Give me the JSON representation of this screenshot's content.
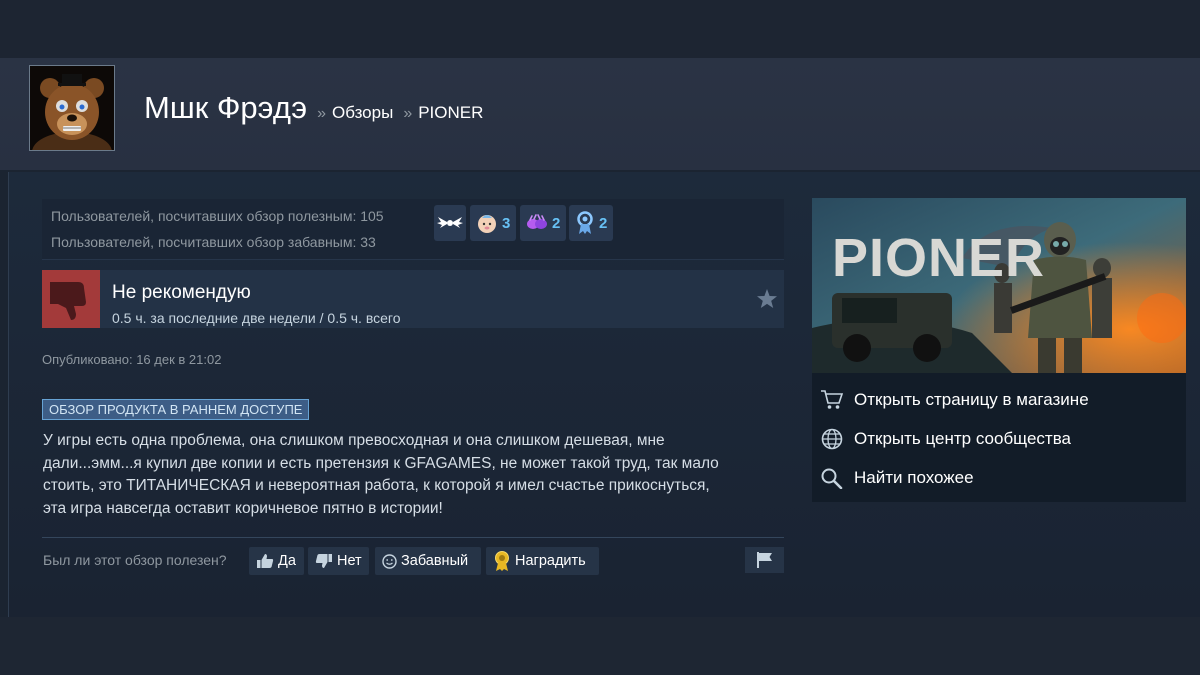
{
  "profile": {
    "username": "Мшк Фрэдэ",
    "breadcrumb": [
      {
        "sep": "»",
        "label": "Обзоры"
      },
      {
        "sep": "»",
        "label": "PIONER"
      }
    ]
  },
  "stats": {
    "helpful_line": "Пользователей, посчитавших обзор полезным: 105",
    "funny_line": "Пользователей, посчитавших обзор забавным: 33"
  },
  "awards": [
    {
      "icon": "wings-award-icon",
      "count": ""
    },
    {
      "icon": "baby-face-award-icon",
      "count": "3"
    },
    {
      "icon": "purple-hands-award-icon",
      "count": "2"
    },
    {
      "icon": "ribbon-medal-award-icon",
      "count": "2"
    }
  ],
  "review": {
    "verdict": "Не рекомендую",
    "hours": "0.5 ч. за последние две недели / 0.5 ч. всего",
    "posted": "Опубликовано: 16 дек в 21:02",
    "early_access_badge": "ОБЗОР ПРОДУКТА В РАННЕМ ДОСТУПЕ",
    "text_lines": [
      "У игры есть одна проблема, она слишком превосходная и она слишком дешевая, мне",
      "дали...эмм...я купил две копии и есть претензия к GFAGAMES, не может такой труд, так мало",
      "стоить, это ТИТАНИЧЕСКАЯ и невероятная работа, к которой я имел счастье прикоснуться,",
      "эта игра навсегда оставит коричневое пятно в истории!"
    ]
  },
  "voting": {
    "question": "Был ли этот обзор полезен?",
    "yes": "Да",
    "no": "Нет",
    "funny": "Забавный",
    "award": "Наградить"
  },
  "game": {
    "logo_text": "PIONER",
    "links": [
      {
        "icon": "cart-icon",
        "label": "Открыть страницу в магазине"
      },
      {
        "icon": "globe-icon",
        "label": "Открыть центр сообщества"
      },
      {
        "icon": "search-icon",
        "label": "Найти похожее"
      }
    ]
  },
  "colors": {
    "background": "#1b2431",
    "header": "#2a3344",
    "not_recommended": "#a33a3a",
    "link_blue": "#67c1f5",
    "badge_blue": "#3d5d86"
  }
}
